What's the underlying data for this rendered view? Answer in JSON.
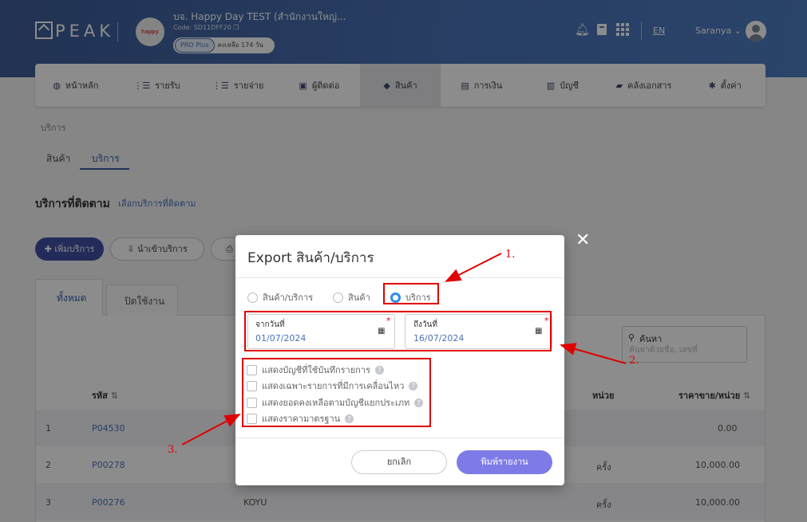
{
  "brand": {
    "logo": "PEAK"
  },
  "company": {
    "name": "บจ. Happy Day TEST (สำนักงานใหญ่...",
    "code": "Code: SD11DFF20",
    "plan": "PRO Plus",
    "days_left": "คงเหลือ 174 วัน",
    "logo_text": "happy"
  },
  "topbar": {
    "lang": "EN",
    "user": "Saranya"
  },
  "nav": {
    "items": [
      "หน้าหลัก",
      "รายรับ",
      "รายจ่าย",
      "ผู้ติดต่อ",
      "สินค้า",
      "การเงิน",
      "บัญชี",
      "คลังเอกสาร",
      "ตั้งค่า"
    ],
    "icons": [
      "dashboard-icon",
      "list-icon",
      "list-icon",
      "contact-icon",
      "box-icon",
      "money-icon",
      "book-icon",
      "folder-icon",
      "gear-icon"
    ]
  },
  "page": {
    "breadcrumb": "บริการ",
    "tabs": [
      "สินค้า",
      "บริการ"
    ],
    "section_title": "บริการที่ติดตาม",
    "section_link": "เลือกบริการที่ติดตาม",
    "add_button": "เพิ่มบริการ",
    "import_button": "นำเข้าบริการ",
    "table_tabs": [
      "ทั้งหมด",
      "ปิดใช้งาน"
    ],
    "search_label": "ค้นหา",
    "search_placeholder": "ค้นหาด้วยชื่อ, เลขที่",
    "columns": {
      "code": "รหัส",
      "unit": "หน่วย",
      "price": "ราคาขาย/หน่วย"
    },
    "rows": [
      {
        "no": "1",
        "code": "P04530",
        "name": "",
        "unit": "",
        "price": "0.00"
      },
      {
        "no": "2",
        "code": "P00278",
        "name": "",
        "unit": "ครั้ง",
        "price": "10,000.00"
      },
      {
        "no": "3",
        "code": "P00276",
        "name": "KOYU",
        "unit": "ครั้ง",
        "price": "10,000.00"
      }
    ]
  },
  "modal": {
    "title": "Export สินค้า/บริการ",
    "radio_options": [
      "สินค้า/บริการ",
      "สินค้า",
      "บริการ"
    ],
    "selected_radio": "บริการ",
    "from_label": "จากวันที่",
    "from_value": "01/07/2024",
    "to_label": "ถึงวันที่",
    "to_value": "16/07/2024",
    "required_mark": "*",
    "checkboxes": [
      "แสดงบัญชีที่ใช้บันทึกรายการ",
      "แสดงเฉพาะรายการที่มีการเคลื่อนไหว",
      "แสดงยอดคงเหลือตามบัญชีแยกประเภท",
      "แสดงราคามาตรฐาน"
    ],
    "cancel_button": "ยกเลิก",
    "print_button": "พิมพ์รายงาน"
  },
  "annotations": [
    "1.",
    "2.",
    "3."
  ],
  "colors": {
    "topbar": "#4a73b8",
    "primary": "#3f4fa5",
    "accent_button": "#7e7be8",
    "highlight": "#e00000",
    "link": "#4a73b8"
  }
}
